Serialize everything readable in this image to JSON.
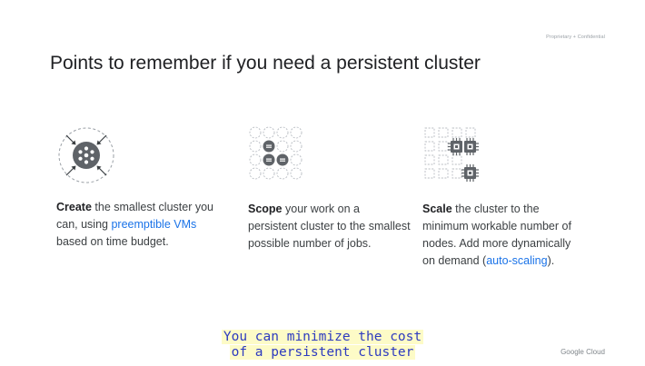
{
  "header": {
    "confidentiality": "Proprietary + Confidential",
    "title": "Points to remember if you need a persistent cluster"
  },
  "columns": [
    {
      "icon": "compress-cluster-icon",
      "bold": "Create",
      "pre_link": " the smallest cluster you can, using ",
      "link": "preemptible VMs",
      "post_link": " based on time budget."
    },
    {
      "icon": "scoped-jobs-grid-icon",
      "bold": "Scope",
      "text": " your work on a persistent cluster to the smallest possible number of jobs."
    },
    {
      "icon": "scale-nodes-chips-icon",
      "bold": "Scale",
      "pre_link": " the cluster to the minimum workable number of nodes. Add more dynamically on demand (",
      "link": "auto-scaling",
      "post_link": ")."
    }
  ],
  "caption": {
    "line1": "You can minimize the cost",
    "line2": "of a persistent cluster"
  },
  "footer": {
    "logo_text": "Google Cloud"
  },
  "colors": {
    "link": "#1a73e8",
    "icon_dark": "#5f6368",
    "caption_text": "#2e3bbf",
    "caption_bg": "#fdfbc7"
  }
}
